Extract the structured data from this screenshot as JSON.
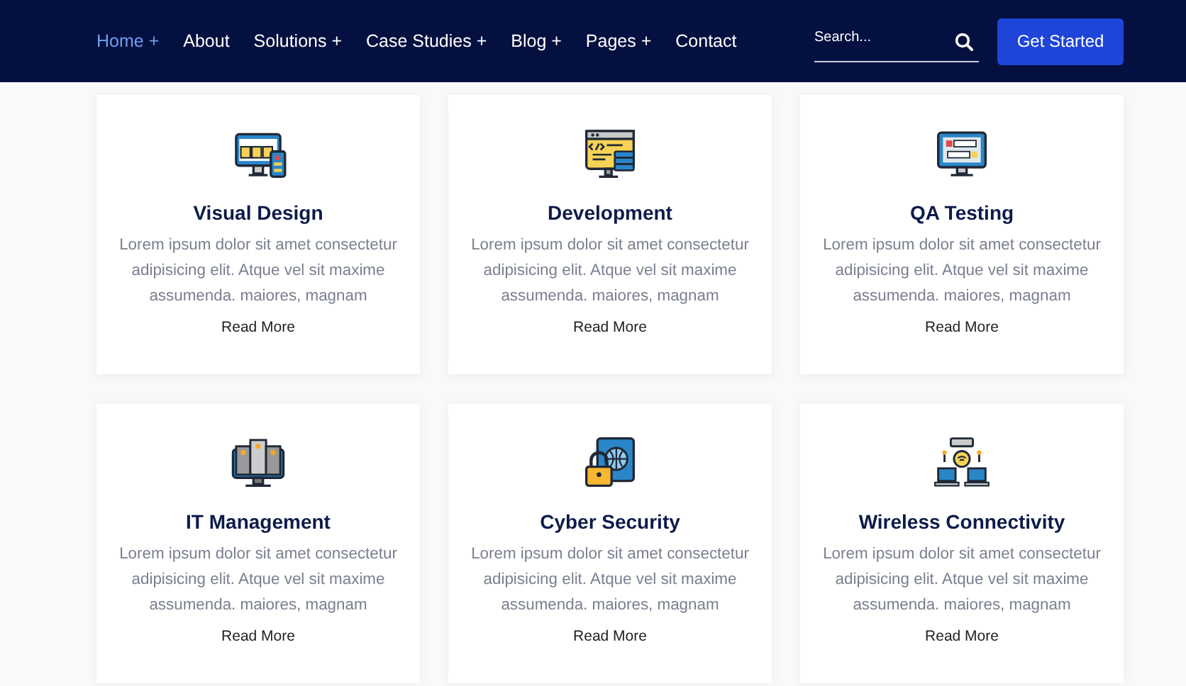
{
  "nav": {
    "items": [
      {
        "label": "Home +",
        "selected": true
      },
      {
        "label": "About",
        "selected": false
      },
      {
        "label": "Solutions +",
        "selected": false
      },
      {
        "label": "Case Studies +",
        "selected": false
      },
      {
        "label": "Blog +",
        "selected": false
      },
      {
        "label": "Pages +",
        "selected": false
      },
      {
        "label": "Contact",
        "selected": false
      }
    ],
    "search": {
      "placeholder": "Search..."
    },
    "cta": "Get Started"
  },
  "services": [
    {
      "kind": "design",
      "title": "Visual Design",
      "text": "Lorem ipsum dolor sit amet consectetur adipisicing elit. Atque vel sit maxime assumenda. maiores, magnam",
      "link": "Read More"
    },
    {
      "kind": "code",
      "title": "Development",
      "text": "Lorem ipsum dolor sit amet consectetur adipisicing elit. Atque vel sit maxime assumenda. maiores, magnam",
      "link": "Read More"
    },
    {
      "kind": "qa",
      "title": "QA Testing",
      "text": "Lorem ipsum dolor sit amet consectetur adipisicing elit. Atque vel sit maxime assumenda. maiores, magnam",
      "link": "Read More"
    },
    {
      "kind": "servers",
      "title": "IT Management",
      "text": "Lorem ipsum dolor sit amet consectetur adipisicing elit. Atque vel sit maxime assumenda. maiores, magnam",
      "link": "Read More"
    },
    {
      "kind": "security",
      "title": "Cyber Security",
      "text": "Lorem ipsum dolor sit amet consectetur adipisicing elit. Atque vel sit maxime assumenda. maiores, magnam",
      "link": "Read More"
    },
    {
      "kind": "wireless",
      "title": "Wireless Connectivity",
      "text": "Lorem ipsum dolor sit amet consectetur adipisicing elit. Atque vel sit maxime assumenda. maiores, magnam",
      "link": "Read More"
    }
  ]
}
